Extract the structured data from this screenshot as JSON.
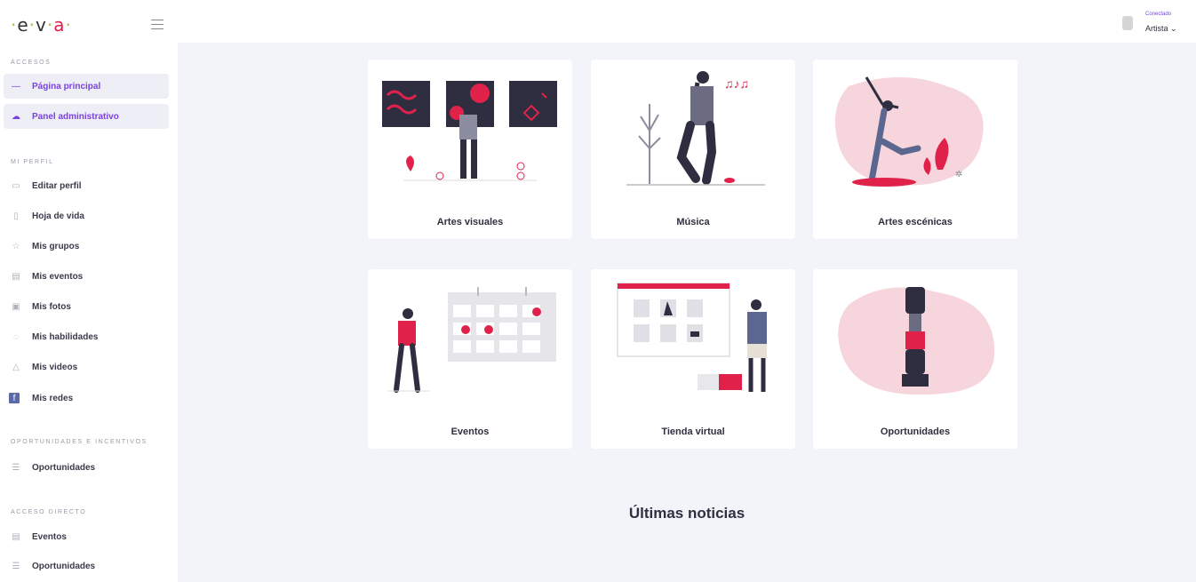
{
  "brand": {
    "letters": [
      "e",
      "v",
      "a"
    ]
  },
  "topbar": {
    "user_status": "Conectado",
    "user_role": "Artista ⌄"
  },
  "sidebar": {
    "sections": [
      {
        "title": "ACCESOS"
      },
      {
        "title": "MI PERFIL"
      },
      {
        "title": "OPORTUNIDADES E INCENTIVOS"
      },
      {
        "title": "ACCESO DIRECTO"
      }
    ],
    "items": [
      {
        "label": "Página principal",
        "icon": "dash-icon",
        "glyph": "—"
      },
      {
        "label": "Panel administrativo",
        "icon": "cloud-icon",
        "glyph": "☁"
      },
      {
        "label": "Editar perfil",
        "icon": "briefcase-icon",
        "glyph": "▭"
      },
      {
        "label": "Hoja de vida",
        "icon": "mic-icon",
        "glyph": "▯"
      },
      {
        "label": "Mis grupos",
        "icon": "star-icon",
        "glyph": "☆"
      },
      {
        "label": "Mis eventos",
        "icon": "calendar-icon",
        "glyph": "▤"
      },
      {
        "label": "Mis fotos",
        "icon": "image-icon",
        "glyph": "▣"
      },
      {
        "label": "Mis habilidades",
        "icon": "spinner-icon",
        "glyph": "◌"
      },
      {
        "label": "Mis videos",
        "icon": "video-icon",
        "glyph": "△"
      },
      {
        "label": "Mis redes",
        "icon": "facebook-icon",
        "glyph": "f"
      },
      {
        "label": "Oportunidades",
        "icon": "list-icon",
        "glyph": "☰"
      },
      {
        "label": "Eventos",
        "icon": "calendar-icon",
        "glyph": "▤"
      },
      {
        "label": "Oportunidades",
        "icon": "list-icon",
        "glyph": "☰"
      }
    ]
  },
  "cards": [
    {
      "label": "Artes visuales",
      "illustration": "gallery-illustration"
    },
    {
      "label": "Música",
      "illustration": "music-illustration"
    },
    {
      "label": "Artes escénicas",
      "illustration": "dancer-illustration"
    },
    {
      "label": "Eventos",
      "illustration": "calendar-illustration"
    },
    {
      "label": "Tienda virtual",
      "illustration": "shop-illustration"
    },
    {
      "label": "Oportunidades",
      "illustration": "opportunity-illustration"
    }
  ],
  "news": {
    "title": "Últimas noticias"
  },
  "colors": {
    "accent": "#7b3fe4",
    "brand_red": "#e0224a",
    "dark": "#2f2e41",
    "background": "#f3f4fa"
  }
}
